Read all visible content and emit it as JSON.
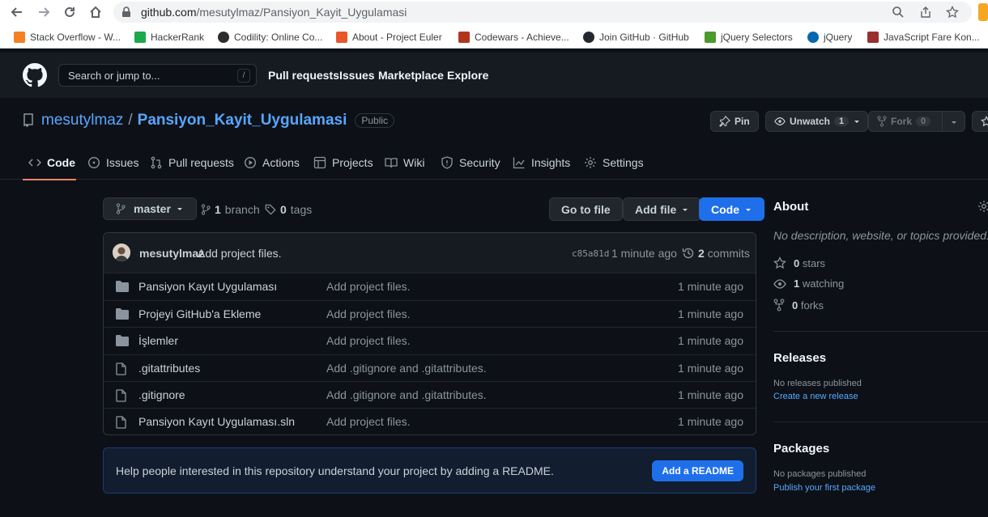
{
  "browser": {
    "url_host": "github.com",
    "url_path": "/mesutylmaz/Pansiyon_Kayit_Uygulamasi",
    "bookmarks": [
      {
        "label": "Stack Overflow - W...",
        "color": "#f48024"
      },
      {
        "label": "HackerRank",
        "color": "#1ba94c"
      },
      {
        "label": "Codility: Online Co...",
        "color": "#2d2d2d"
      },
      {
        "label": "About - Project Euler",
        "color": "#e8562a"
      },
      {
        "label": "Codewars - Achieve...",
        "color": "#b1361e"
      },
      {
        "label": "Join GitHub · GitHub",
        "color": "#24292f"
      },
      {
        "label": "jQuery Selectors",
        "color": "#4b9a2c"
      },
      {
        "label": "jQuery",
        "color": "#0769ad"
      },
      {
        "label": "JavaScript Fare Kon...",
        "color": "#9a2f2f"
      }
    ]
  },
  "gh_header": {
    "search_placeholder": "Search or jump to...",
    "search_shortcut": "/",
    "nav": [
      "Pull requests",
      "Issues",
      "Marketplace",
      "Explore"
    ]
  },
  "repo": {
    "owner": "mesutylmaz",
    "separator": "/",
    "name": "Pansiyon_Kayit_Uygulamasi",
    "visibility": "Public",
    "pin_label": "Pin",
    "unwatch_label": "Unwatch",
    "unwatch_count": "1",
    "fork_label": "Fork",
    "fork_count": "0"
  },
  "tabs": [
    {
      "label": "Code",
      "icon": "code-icon",
      "active": true
    },
    {
      "label": "Issues",
      "icon": "issue-icon"
    },
    {
      "label": "Pull requests",
      "icon": "pull-request-icon"
    },
    {
      "label": "Actions",
      "icon": "play-icon"
    },
    {
      "label": "Projects",
      "icon": "table-icon"
    },
    {
      "label": "Wiki",
      "icon": "book-icon"
    },
    {
      "label": "Security",
      "icon": "shield-icon"
    },
    {
      "label": "Insights",
      "icon": "graph-icon"
    },
    {
      "label": "Settings",
      "icon": "gear-icon"
    }
  ],
  "toolbar": {
    "branch": "master",
    "branch_count": "1",
    "branch_word": "branch",
    "tag_count": "0",
    "tag_word": "tags",
    "go_to_file": "Go to file",
    "add_file": "Add file",
    "code": "Code"
  },
  "commit": {
    "author": "mesutylmaz",
    "message": "Add project files.",
    "sha": "c85a81d",
    "time": "1 minute ago",
    "count": "2",
    "count_word": "commits"
  },
  "files": [
    {
      "name": "Pansiyon Kayıt Uygulaması",
      "type": "dir",
      "message": "Add project files.",
      "time": "1 minute ago"
    },
    {
      "name": "Projeyi GitHub'a Ekleme",
      "type": "dir",
      "message": "Add project files.",
      "time": "1 minute ago"
    },
    {
      "name": "İşlemler",
      "type": "dir",
      "message": "Add project files.",
      "time": "1 minute ago"
    },
    {
      "name": ".gitattributes",
      "type": "file",
      "message": "Add .gitignore and .gitattributes.",
      "time": "1 minute ago"
    },
    {
      "name": ".gitignore",
      "type": "file",
      "message": "Add .gitignore and .gitattributes.",
      "time": "1 minute ago"
    },
    {
      "name": "Pansiyon Kayıt Uygulaması.sln",
      "type": "file",
      "message": "Add project files.",
      "time": "1 minute ago"
    }
  ],
  "readme_prompt": {
    "text": "Help people interested in this repository understand your project by adding a README.",
    "button": "Add a README"
  },
  "about": {
    "title": "About",
    "description": "No description, website, or topics provided.",
    "stars_count": "0",
    "stars_word": "stars",
    "watching_count": "1",
    "watching_word": "watching",
    "forks_count": "0",
    "forks_word": "forks"
  },
  "releases": {
    "title": "Releases",
    "empty": "No releases published",
    "link": "Create a new release"
  },
  "packages": {
    "title": "Packages",
    "empty": "No packages published",
    "link": "Publish your first package"
  },
  "colors": {
    "accent_blue": "#1f6feb",
    "link_blue": "#58a6ff",
    "active_tab_underline": "#f78166",
    "background": "#0d1117"
  }
}
